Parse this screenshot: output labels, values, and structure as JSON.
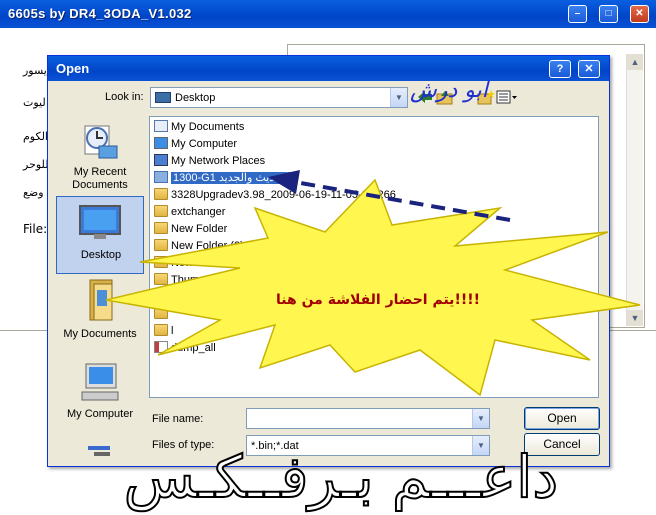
{
  "window": {
    "title": "6605s by DR4_3ODA_V1.032",
    "side_labels": [
      "يسور",
      "ليوت",
      "الكوم",
      "للوحر",
      "وضع"
    ],
    "file_label": "File:"
  },
  "dialog": {
    "title": "Open",
    "help_btn": "?",
    "close_btn": "✕",
    "look_in_label": "Look in:",
    "look_in_value": "Desktop",
    "places": [
      {
        "label": "My Recent\nDocuments",
        "icon": "recent-documents-icon"
      },
      {
        "label": "Desktop",
        "icon": "desktop-icon",
        "selected": true
      },
      {
        "label": "My Documents",
        "icon": "my-documents-icon"
      },
      {
        "label": "My Computer",
        "icon": "my-computer-icon"
      },
      {
        "label": "",
        "icon": "network-icon"
      }
    ],
    "files": [
      {
        "name": "My Documents",
        "icon": "my-documents-icon"
      },
      {
        "name": "My Computer",
        "icon": "my-computer-icon"
      },
      {
        "name": "My Network Places",
        "icon": "network-places-icon"
      },
      {
        "name": "1300-G1 التحديث والجديد",
        "icon": "folder-icon",
        "selected": true
      },
      {
        "name": "3328Upgradev3.98_2009-06-19-11-05-01-266",
        "icon": "folder-icon"
      },
      {
        "name": "extchanger",
        "icon": "folder-icon"
      },
      {
        "name": "New Folder",
        "icon": "folder-icon"
      },
      {
        "name": "New Folder (2)",
        "icon": "folder-icon"
      },
      {
        "name": "New Folder",
        "icon": "folder-icon"
      },
      {
        "name": "Thum",
        "icon": "folder-icon"
      },
      {
        "name": "",
        "icon": "folder-icon"
      },
      {
        "name": "",
        "icon": "folder-icon"
      },
      {
        "name": "l",
        "icon": "folder-icon"
      },
      {
        "name": "dump_all",
        "icon": "file-icon"
      }
    ],
    "file_name_label": "File name:",
    "file_name_value": "",
    "file_type_label": "Files of type:",
    "file_type_value": "*.bin;*.dat",
    "open_btn": "Open",
    "cancel_btn": "Cancel"
  },
  "overlay": {
    "handle_text": "ابو درش",
    "callout_text": "يتم احضار الفلاشة من هنا!!!!",
    "banner_text": "داعـــم بـرفــكـس"
  },
  "colors": {
    "titlebar": "#0a52d6",
    "selection": "#316ac5",
    "burst_fill": "#fff64f",
    "arrow": "#1a237e"
  }
}
